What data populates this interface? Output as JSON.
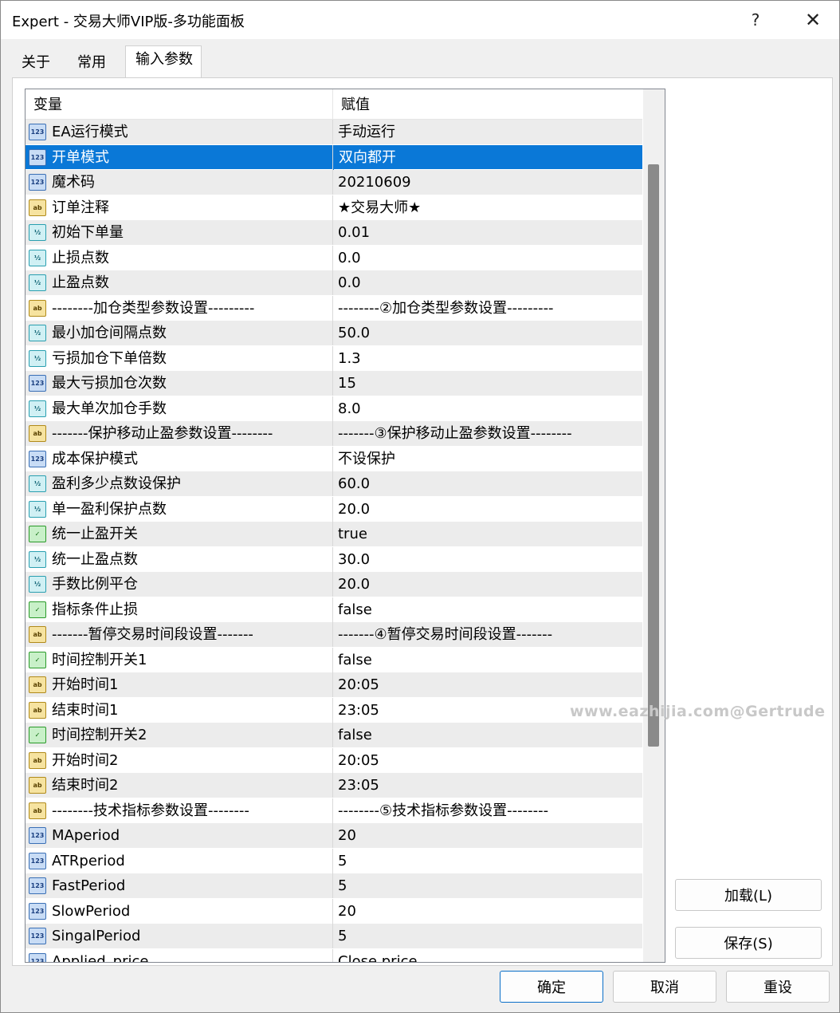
{
  "window": {
    "title": "Expert - 交易大师VIP版-多功能面板",
    "help_label": "?",
    "close_label": "✕"
  },
  "tabs": [
    {
      "label": "关于"
    },
    {
      "label": "常用"
    },
    {
      "label": "输入参数"
    }
  ],
  "grid": {
    "header_variable": "变量",
    "header_value": "赋值",
    "rows": [
      {
        "icon": "123",
        "name": "EA运行模式",
        "value": "手动运行"
      },
      {
        "icon": "123",
        "name": "开单模式",
        "value": "双向都开",
        "selected": true
      },
      {
        "icon": "123",
        "name": "魔术码",
        "value": "20210609"
      },
      {
        "icon": "ab",
        "name": "订单注释",
        "value": "★交易大师★"
      },
      {
        "icon": "1/2",
        "name": "初始下单量",
        "value": "0.01"
      },
      {
        "icon": "1/2",
        "name": "止损点数",
        "value": "0.0"
      },
      {
        "icon": "1/2",
        "name": "止盈点数",
        "value": "0.0"
      },
      {
        "icon": "ab",
        "name": "--------加仓类型参数设置---------",
        "value": "--------②加仓类型参数设置---------"
      },
      {
        "icon": "1/2",
        "name": "最小加仓间隔点数",
        "value": "50.0"
      },
      {
        "icon": "1/2",
        "name": "亏损加仓下单倍数",
        "value": "1.3"
      },
      {
        "icon": "123",
        "name": "最大亏损加仓次数",
        "value": "15"
      },
      {
        "icon": "1/2",
        "name": "最大单次加仓手数",
        "value": "8.0"
      },
      {
        "icon": "ab",
        "name": "-------保护移动止盈参数设置--------",
        "value": "-------③保护移动止盈参数设置--------"
      },
      {
        "icon": "123",
        "name": "成本保护模式",
        "value": "不设保护"
      },
      {
        "icon": "1/2",
        "name": "盈利多少点数设保护",
        "value": "60.0"
      },
      {
        "icon": "1/2",
        "name": "单一盈利保护点数",
        "value": "20.0"
      },
      {
        "icon": "bool",
        "name": "统一止盈开关",
        "value": "true"
      },
      {
        "icon": "1/2",
        "name": "统一止盈点数",
        "value": "30.0"
      },
      {
        "icon": "1/2",
        "name": "手数比例平仓",
        "value": "20.0"
      },
      {
        "icon": "bool",
        "name": "指标条件止损",
        "value": "false"
      },
      {
        "icon": "ab",
        "name": "-------暂停交易时间段设置-------",
        "value": "-------④暂停交易时间段设置-------"
      },
      {
        "icon": "bool",
        "name": "时间控制开关1",
        "value": "false"
      },
      {
        "icon": "ab",
        "name": "开始时间1",
        "value": "20:05"
      },
      {
        "icon": "ab",
        "name": "结束时间1",
        "value": "23:05"
      },
      {
        "icon": "bool",
        "name": "时间控制开关2",
        "value": "false"
      },
      {
        "icon": "ab",
        "name": "开始时间2",
        "value": "20:05"
      },
      {
        "icon": "ab",
        "name": "结束时间2",
        "value": "23:05"
      },
      {
        "icon": "ab",
        "name": "--------技术指标参数设置--------",
        "value": "--------⑤技术指标参数设置--------"
      },
      {
        "icon": "123",
        "name": "MAperiod",
        "value": "20"
      },
      {
        "icon": "123",
        "name": "ATRperiod",
        "value": "5"
      },
      {
        "icon": "123",
        "name": "FastPeriod",
        "value": "5"
      },
      {
        "icon": "123",
        "name": "SlowPeriod",
        "value": "20"
      },
      {
        "icon": "123",
        "name": "SingalPeriod",
        "value": "5"
      },
      {
        "icon": "123",
        "name": "Applied_price",
        "value": "Close price"
      }
    ]
  },
  "watermark": "www.eazhijia.com@Gertrude",
  "buttons": {
    "load": "加载(L)",
    "save": "保存(S)",
    "ok": "确定",
    "cancel": "取消",
    "reset": "重设"
  }
}
